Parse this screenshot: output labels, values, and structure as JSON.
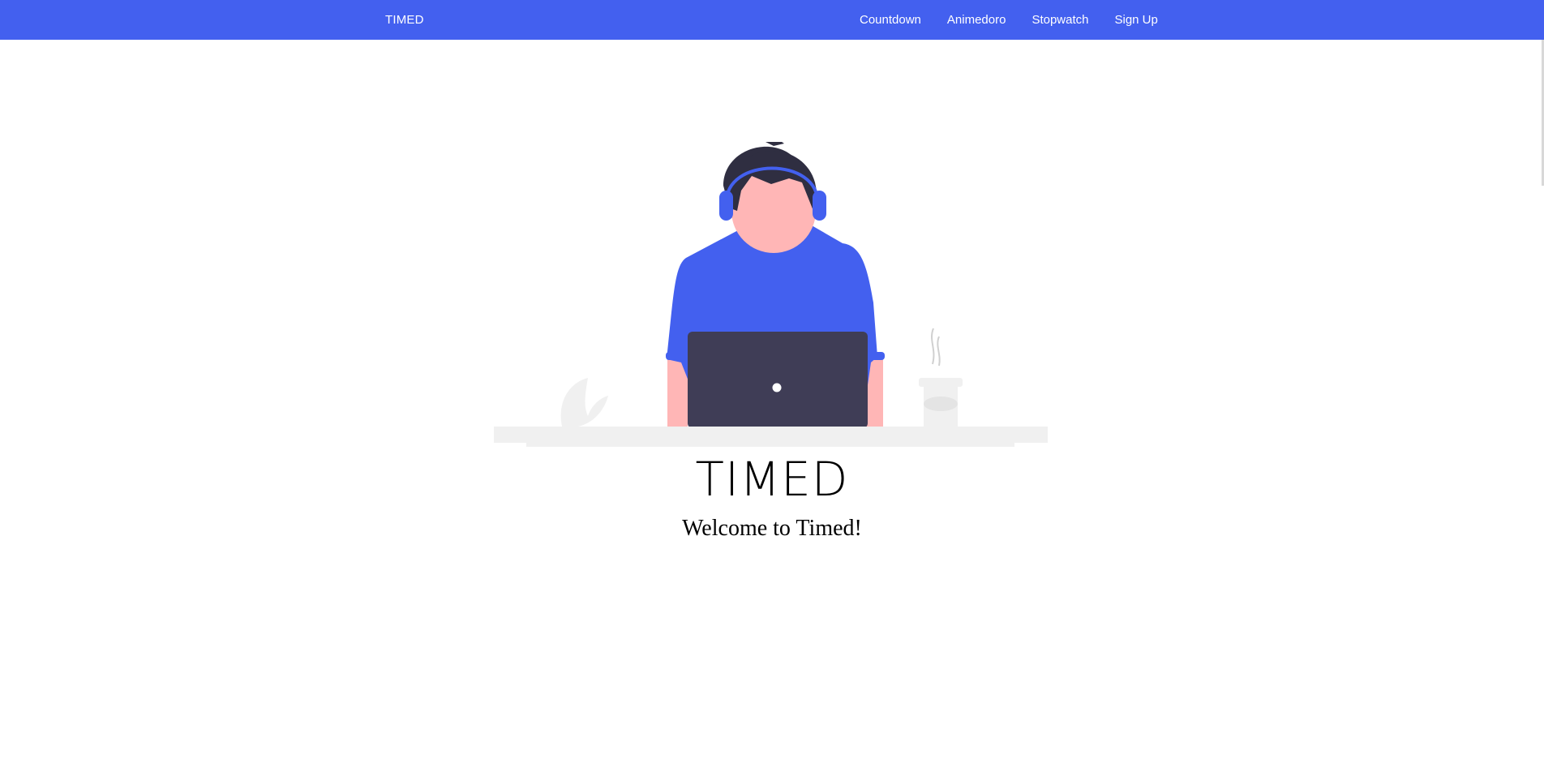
{
  "navbar": {
    "brand": "TIMED",
    "links": [
      {
        "label": "Countdown"
      },
      {
        "label": "Animedoro"
      },
      {
        "label": "Stopwatch"
      },
      {
        "label": "Sign Up"
      }
    ],
    "background_color": "#4360ef"
  },
  "hero": {
    "illustration_icon": "person-with-headphones-at-laptop-illustration",
    "title": "TIMED",
    "subtitle": "Welcome to Timed!"
  },
  "colors": {
    "accent": "#4360ef",
    "skin": "#ffb6b6",
    "hair": "#2f2e41",
    "laptop": "#3f3d56",
    "desk": "#f0f0f0"
  }
}
